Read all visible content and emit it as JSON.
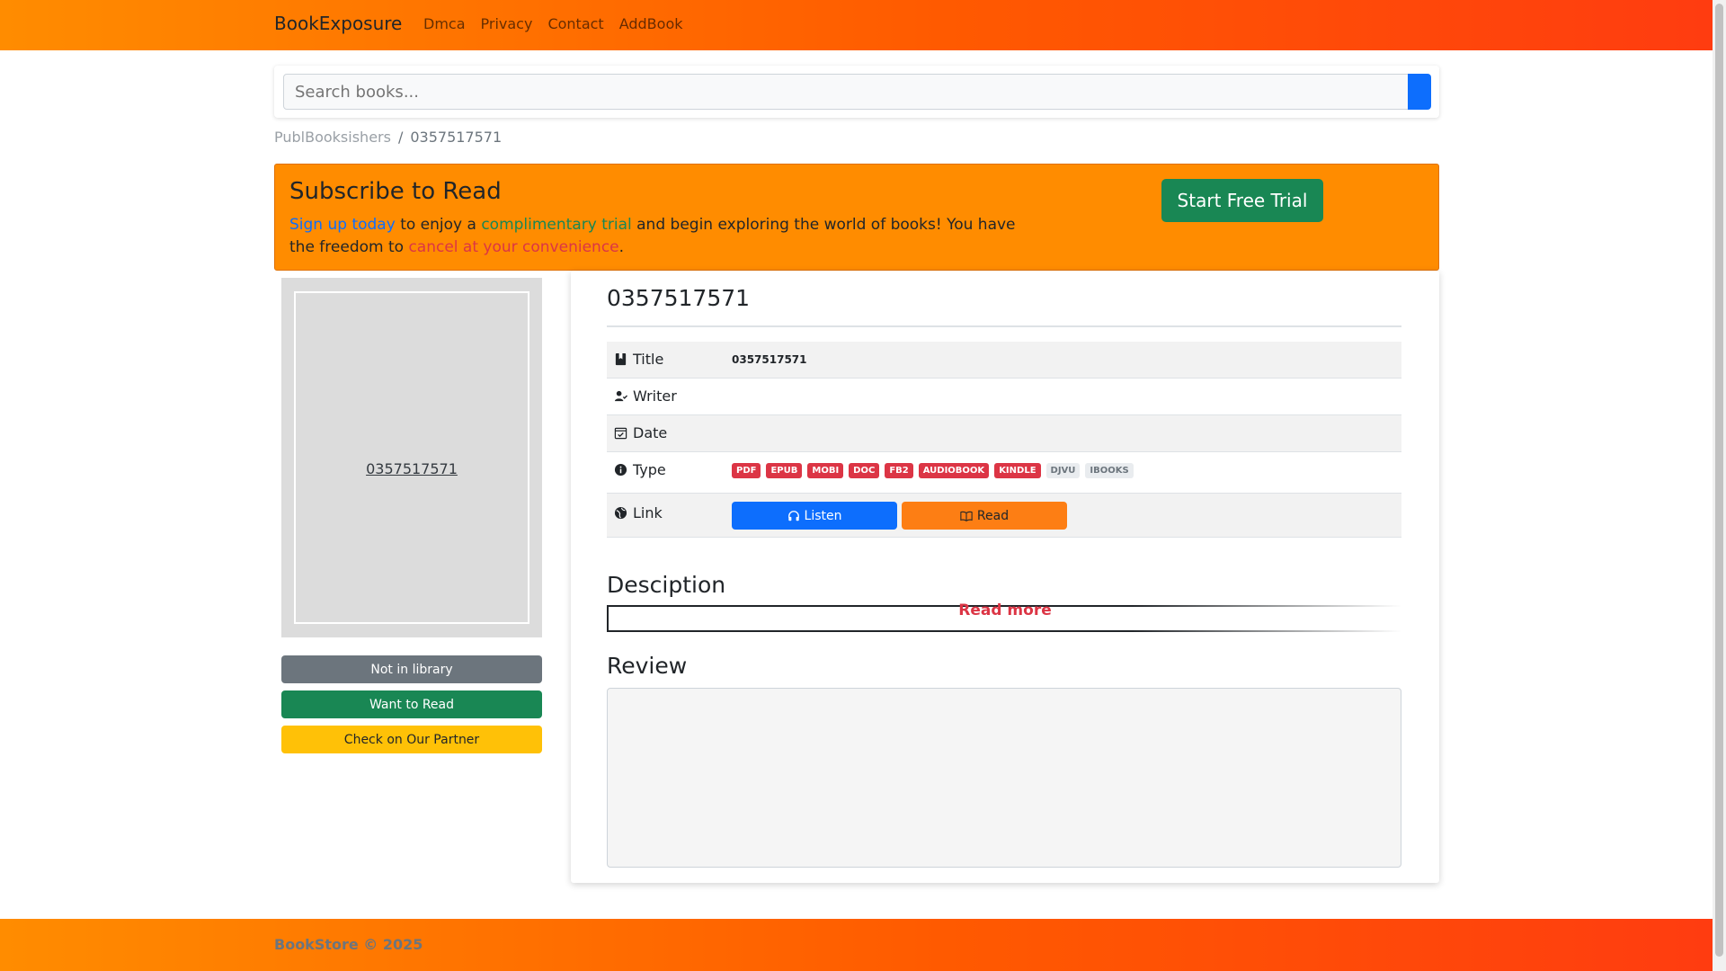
{
  "navbar": {
    "brand": "BookExposure",
    "links": [
      "Dmca",
      "Privacy",
      "Contact",
      "AddBook"
    ]
  },
  "search": {
    "placeholder": "Search books..."
  },
  "breadcrumb": {
    "parent": "PublBooksishers",
    "separator": "/",
    "current": "0357517571"
  },
  "banner": {
    "title": "Subscribe to Read",
    "text_signup": "Sign up today",
    "text_1": " to enjoy a ",
    "text_trial": "complimentary trial",
    "text_2": " and begin exploring the world of books! You have the freedom to ",
    "text_cancel": "cancel at your convenience",
    "text_3": ".",
    "button": "Start Free Trial"
  },
  "cover": {
    "title_link": "0357517571"
  },
  "sidebar_buttons": {
    "not_in_library": "Not in library",
    "want_to_read": "Want to Read",
    "partner": "Check on Our Partner"
  },
  "book": {
    "heading": "0357517571",
    "labels": {
      "title": "Title",
      "writer": "Writer",
      "date": "Date",
      "type": "Type",
      "link": "Link"
    },
    "title_value": "0357517571",
    "writer_value": "",
    "date_value": "",
    "formats_available": [
      "PDF",
      "EPUB",
      "MOBI",
      "DOC",
      "FB2",
      "AUDIOBOOK",
      "KINDLE"
    ],
    "formats_unavailable": [
      "DJVU",
      "IBOOKS"
    ],
    "listen_label": "Listen",
    "read_label": "Read"
  },
  "description": {
    "title": "Desciption",
    "read_more": "Read more"
  },
  "review": {
    "title": "Review",
    "value": ""
  },
  "footer": {
    "text": "BookStore © 2025"
  },
  "colors": {
    "nav_gradient_start": "#ff8c00",
    "nav_gradient_end": "#ff3c10",
    "banner": "#ff8c00",
    "primary": "#0d6efd",
    "success": "#198754",
    "danger": "#dc3545",
    "warning": "#ffc107"
  }
}
